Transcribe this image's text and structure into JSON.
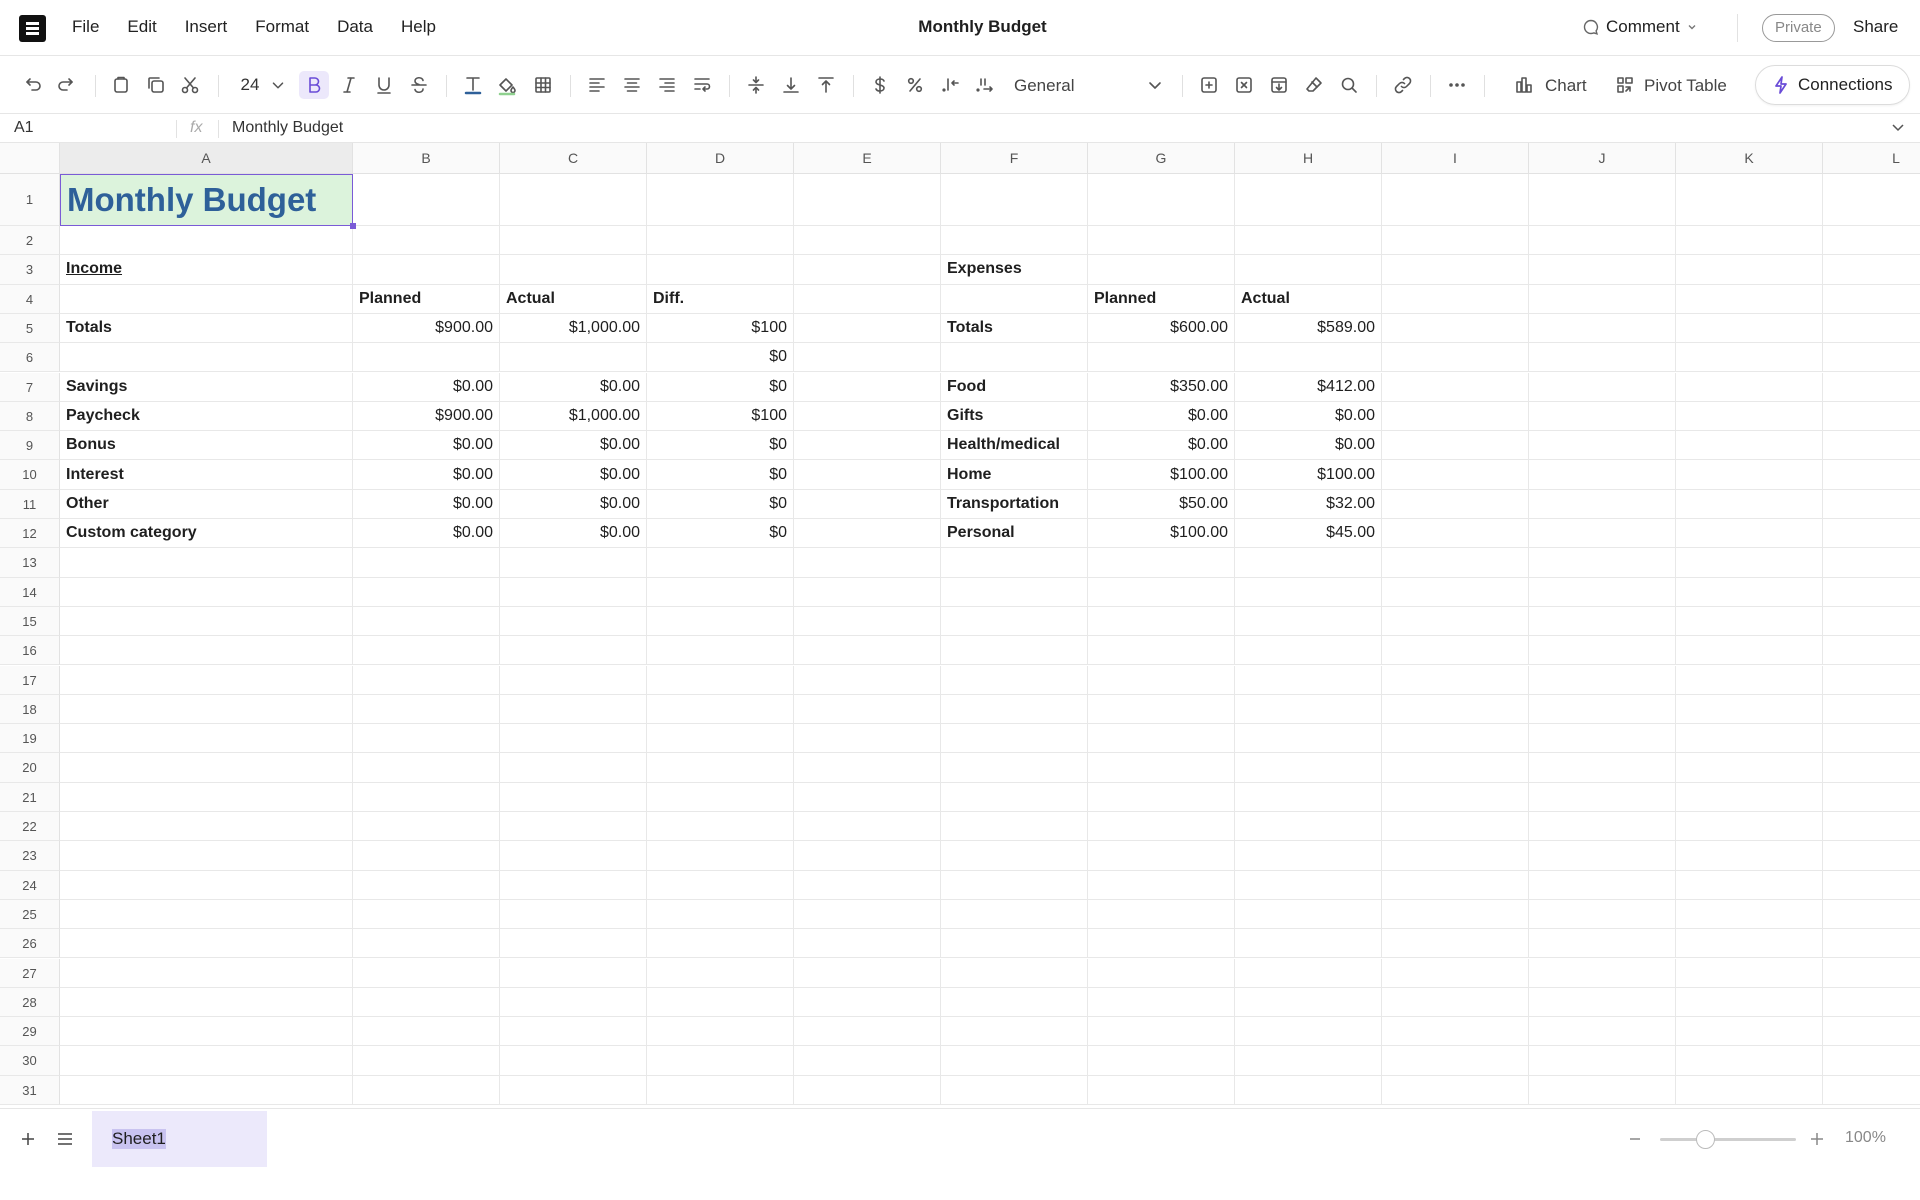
{
  "menubar": {
    "menus": [
      "File",
      "Edit",
      "Insert",
      "Format",
      "Data",
      "Help"
    ],
    "doc_title": "Monthly Budget",
    "comment_label": "Comment",
    "private_label": "Private",
    "share_label": "Share"
  },
  "toolbar": {
    "font_size": "24",
    "number_format": "General",
    "chart_label": "Chart",
    "pivot_label": "Pivot Table",
    "connections_label": "Connections",
    "accent_color": "#6a4cd7"
  },
  "formula_bar": {
    "cell_ref": "A1",
    "fx": "fx",
    "value": "Monthly Budget"
  },
  "sheet": {
    "columns": [
      "A",
      "B",
      "C",
      "D",
      "E",
      "F",
      "G",
      "H",
      "I",
      "J",
      "K",
      "L"
    ],
    "selected_column": "A",
    "row_count": 31,
    "cells": {
      "A1": "Monthly Budget",
      "A3": "Income",
      "B4": "Planned",
      "C4": "Actual",
      "D4": "Diff.",
      "A5": "Totals",
      "B5": "$900.00",
      "C5": "$1,000.00",
      "D5": "$100",
      "D6": "$0",
      "A7": "Savings",
      "B7": "$0.00",
      "C7": "$0.00",
      "D7": "$0",
      "A8": "Paycheck",
      "B8": "$900.00",
      "C8": "$1,000.00",
      "D8": "$100",
      "A9": "Bonus",
      "B9": "$0.00",
      "C9": "$0.00",
      "D9": "$0",
      "A10": "Interest",
      "B10": "$0.00",
      "C10": "$0.00",
      "D10": "$0",
      "A11": "Other",
      "B11": "$0.00",
      "C11": "$0.00",
      "D11": "$0",
      "A12": "Custom category",
      "B12": "$0.00",
      "C12": "$0.00",
      "D12": "$0",
      "F3": "Expenses",
      "G4": "Planned",
      "H4": "Actual",
      "F5": "Totals",
      "G5": "$600.00",
      "H5": "$589.00",
      "F7": "Food",
      "G7": "$350.00",
      "H7": "$412.00",
      "F8": "Gifts",
      "G8": "$0.00",
      "H8": "$0.00",
      "F9": "Health/medical",
      "G9": "$0.00",
      "H9": "$0.00",
      "F10": "Home",
      "G10": "$100.00",
      "H10": "$100.00",
      "F11": "Transportation",
      "G11": "$50.00",
      "H11": "$32.00",
      "F12": "Personal",
      "G12": "$100.00",
      "H12": "$45.00"
    },
    "title_fill": "#dcf3dc",
    "title_color": "#2e6099"
  },
  "bottom": {
    "sheet_tab": "Sheet1",
    "zoom_label": "100%",
    "zoom_fraction": 0.33
  }
}
